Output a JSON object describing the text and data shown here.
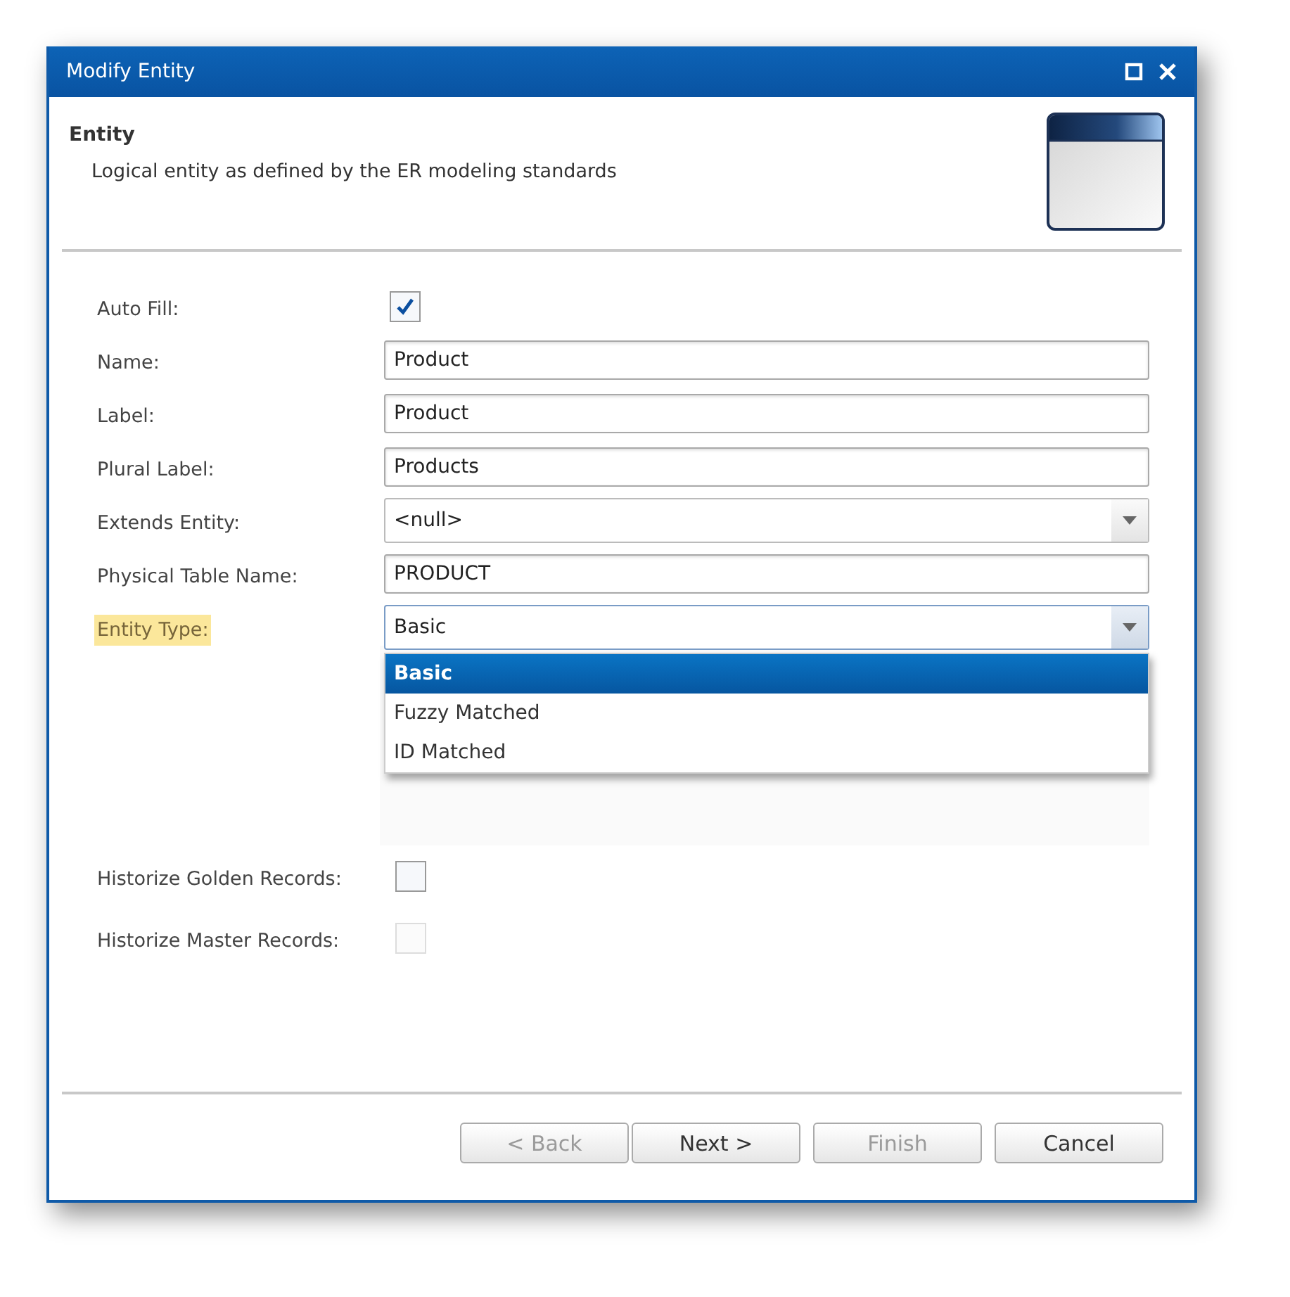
{
  "window": {
    "title": "Modify Entity"
  },
  "header": {
    "title": "Entity",
    "description": "Logical entity as defined by the ER modeling standards"
  },
  "fields": [
    {
      "kind": "checkbox",
      "label": "Auto Fill:",
      "checked": true,
      "highlighted": false
    },
    {
      "kind": "text",
      "label": "Name:",
      "value": "Product",
      "highlighted": false
    },
    {
      "kind": "text",
      "label": "Label:",
      "value": "Product",
      "highlighted": false
    },
    {
      "kind": "text",
      "label": "Plural Label:",
      "value": "Products",
      "highlighted": false
    },
    {
      "kind": "select",
      "label": "Extends Entity:",
      "value": "<null>",
      "highlighted": false
    },
    {
      "kind": "text",
      "label": "Physical Table Name:",
      "value": "PRODUCT",
      "highlighted": false
    },
    {
      "kind": "select",
      "label": "Entity Type:",
      "value": "Basic",
      "highlighted": true,
      "expanded": true,
      "options": [
        {
          "label": "Basic",
          "selected": true
        },
        {
          "label": "Fuzzy Matched",
          "selected": false
        },
        {
          "label": "ID Matched",
          "selected": false
        }
      ]
    }
  ],
  "lower_fields": [
    {
      "label": "Historize Golden Records:",
      "checked": false,
      "disabled": false
    },
    {
      "label": "Historize Master Records:",
      "checked": false,
      "disabled": true
    }
  ],
  "buttons": [
    {
      "label": "< Back",
      "disabled": true
    },
    {
      "label": "Next >",
      "disabled": false
    },
    {
      "label": "Finish",
      "disabled": true
    },
    {
      "label": "Cancel",
      "disabled": false
    }
  ]
}
